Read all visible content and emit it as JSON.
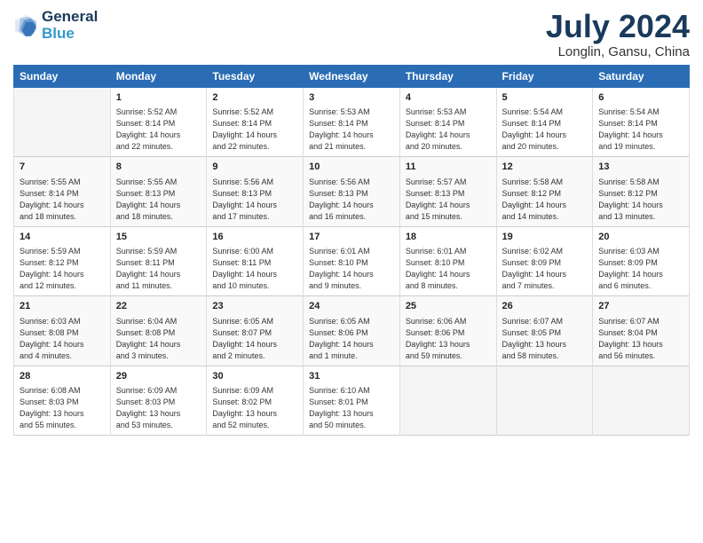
{
  "logo": {
    "line1": "General",
    "line2": "Blue"
  },
  "title": "July 2024",
  "subtitle": "Longlin, Gansu, China",
  "headers": [
    "Sunday",
    "Monday",
    "Tuesday",
    "Wednesday",
    "Thursday",
    "Friday",
    "Saturday"
  ],
  "weeks": [
    [
      {
        "day": "",
        "content": ""
      },
      {
        "day": "1",
        "content": "Sunrise: 5:52 AM\nSunset: 8:14 PM\nDaylight: 14 hours\nand 22 minutes."
      },
      {
        "day": "2",
        "content": "Sunrise: 5:52 AM\nSunset: 8:14 PM\nDaylight: 14 hours\nand 22 minutes."
      },
      {
        "day": "3",
        "content": "Sunrise: 5:53 AM\nSunset: 8:14 PM\nDaylight: 14 hours\nand 21 minutes."
      },
      {
        "day": "4",
        "content": "Sunrise: 5:53 AM\nSunset: 8:14 PM\nDaylight: 14 hours\nand 20 minutes."
      },
      {
        "day": "5",
        "content": "Sunrise: 5:54 AM\nSunset: 8:14 PM\nDaylight: 14 hours\nand 20 minutes."
      },
      {
        "day": "6",
        "content": "Sunrise: 5:54 AM\nSunset: 8:14 PM\nDaylight: 14 hours\nand 19 minutes."
      }
    ],
    [
      {
        "day": "7",
        "content": "Sunrise: 5:55 AM\nSunset: 8:14 PM\nDaylight: 14 hours\nand 18 minutes."
      },
      {
        "day": "8",
        "content": "Sunrise: 5:55 AM\nSunset: 8:13 PM\nDaylight: 14 hours\nand 18 minutes."
      },
      {
        "day": "9",
        "content": "Sunrise: 5:56 AM\nSunset: 8:13 PM\nDaylight: 14 hours\nand 17 minutes."
      },
      {
        "day": "10",
        "content": "Sunrise: 5:56 AM\nSunset: 8:13 PM\nDaylight: 14 hours\nand 16 minutes."
      },
      {
        "day": "11",
        "content": "Sunrise: 5:57 AM\nSunset: 8:13 PM\nDaylight: 14 hours\nand 15 minutes."
      },
      {
        "day": "12",
        "content": "Sunrise: 5:58 AM\nSunset: 8:12 PM\nDaylight: 14 hours\nand 14 minutes."
      },
      {
        "day": "13",
        "content": "Sunrise: 5:58 AM\nSunset: 8:12 PM\nDaylight: 14 hours\nand 13 minutes."
      }
    ],
    [
      {
        "day": "14",
        "content": "Sunrise: 5:59 AM\nSunset: 8:12 PM\nDaylight: 14 hours\nand 12 minutes."
      },
      {
        "day": "15",
        "content": "Sunrise: 5:59 AM\nSunset: 8:11 PM\nDaylight: 14 hours\nand 11 minutes."
      },
      {
        "day": "16",
        "content": "Sunrise: 6:00 AM\nSunset: 8:11 PM\nDaylight: 14 hours\nand 10 minutes."
      },
      {
        "day": "17",
        "content": "Sunrise: 6:01 AM\nSunset: 8:10 PM\nDaylight: 14 hours\nand 9 minutes."
      },
      {
        "day": "18",
        "content": "Sunrise: 6:01 AM\nSunset: 8:10 PM\nDaylight: 14 hours\nand 8 minutes."
      },
      {
        "day": "19",
        "content": "Sunrise: 6:02 AM\nSunset: 8:09 PM\nDaylight: 14 hours\nand 7 minutes."
      },
      {
        "day": "20",
        "content": "Sunrise: 6:03 AM\nSunset: 8:09 PM\nDaylight: 14 hours\nand 6 minutes."
      }
    ],
    [
      {
        "day": "21",
        "content": "Sunrise: 6:03 AM\nSunset: 8:08 PM\nDaylight: 14 hours\nand 4 minutes."
      },
      {
        "day": "22",
        "content": "Sunrise: 6:04 AM\nSunset: 8:08 PM\nDaylight: 14 hours\nand 3 minutes."
      },
      {
        "day": "23",
        "content": "Sunrise: 6:05 AM\nSunset: 8:07 PM\nDaylight: 14 hours\nand 2 minutes."
      },
      {
        "day": "24",
        "content": "Sunrise: 6:05 AM\nSunset: 8:06 PM\nDaylight: 14 hours\nand 1 minute."
      },
      {
        "day": "25",
        "content": "Sunrise: 6:06 AM\nSunset: 8:06 PM\nDaylight: 13 hours\nand 59 minutes."
      },
      {
        "day": "26",
        "content": "Sunrise: 6:07 AM\nSunset: 8:05 PM\nDaylight: 13 hours\nand 58 minutes."
      },
      {
        "day": "27",
        "content": "Sunrise: 6:07 AM\nSunset: 8:04 PM\nDaylight: 13 hours\nand 56 minutes."
      }
    ],
    [
      {
        "day": "28",
        "content": "Sunrise: 6:08 AM\nSunset: 8:03 PM\nDaylight: 13 hours\nand 55 minutes."
      },
      {
        "day": "29",
        "content": "Sunrise: 6:09 AM\nSunset: 8:03 PM\nDaylight: 13 hours\nand 53 minutes."
      },
      {
        "day": "30",
        "content": "Sunrise: 6:09 AM\nSunset: 8:02 PM\nDaylight: 13 hours\nand 52 minutes."
      },
      {
        "day": "31",
        "content": "Sunrise: 6:10 AM\nSunset: 8:01 PM\nDaylight: 13 hours\nand 50 minutes."
      },
      {
        "day": "",
        "content": ""
      },
      {
        "day": "",
        "content": ""
      },
      {
        "day": "",
        "content": ""
      }
    ]
  ]
}
